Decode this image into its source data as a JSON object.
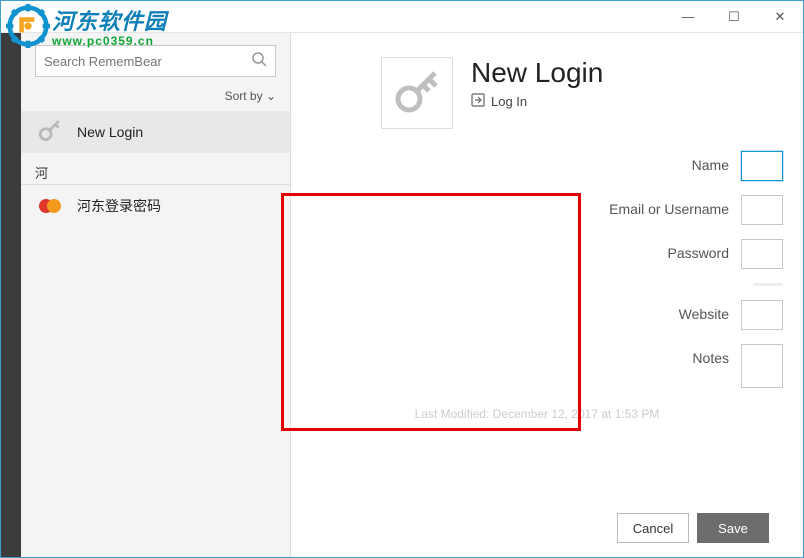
{
  "titlebar": {
    "min": "—",
    "max": "☐",
    "close": "✕"
  },
  "search": {
    "placeholder": "Search RememBear"
  },
  "sort": {
    "label": "Sort by",
    "chev": "⌄"
  },
  "sidebar": {
    "items": [
      {
        "label": "New Login",
        "icon": "key"
      }
    ],
    "group": "河",
    "items2": [
      {
        "label": "河东登录密码",
        "icon": "mc"
      }
    ]
  },
  "header": {
    "title": "New Login",
    "login": "Log In"
  },
  "form": {
    "name_label": "Name",
    "email_label": "Email or Username",
    "password_label": "Password",
    "website_label": "Website",
    "notes_label": "Notes",
    "name": "",
    "email": "",
    "password": "",
    "website": "",
    "notes": ""
  },
  "modified": "Last Modified: December 12, 2017 at 1:53 PM",
  "footer": {
    "cancel": "Cancel",
    "save": "Save"
  },
  "overlay": {
    "cn": "河东软件园",
    "url": "www.pc0359.cn"
  }
}
